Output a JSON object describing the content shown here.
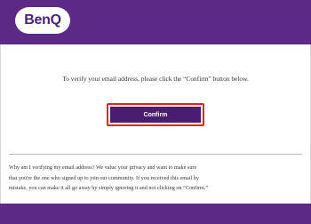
{
  "brand": {
    "logo_text": "BenQ",
    "colors": {
      "purple": "#5c2a86",
      "button": "#4a1d73",
      "highlight": "#e1251b"
    }
  },
  "email": {
    "instruction": "To verify your email address, please click the “Confirm” button below.",
    "confirm_button": "Confirm",
    "note_lines": [
      "Why am I verifying my email address? We value your privacy and want to make sure",
      "that you're the one who signed up to join our community. If you received this email by",
      "mistake, you can make it all go away by simply ignoring it and not clicking on “Confirm.”"
    ]
  }
}
